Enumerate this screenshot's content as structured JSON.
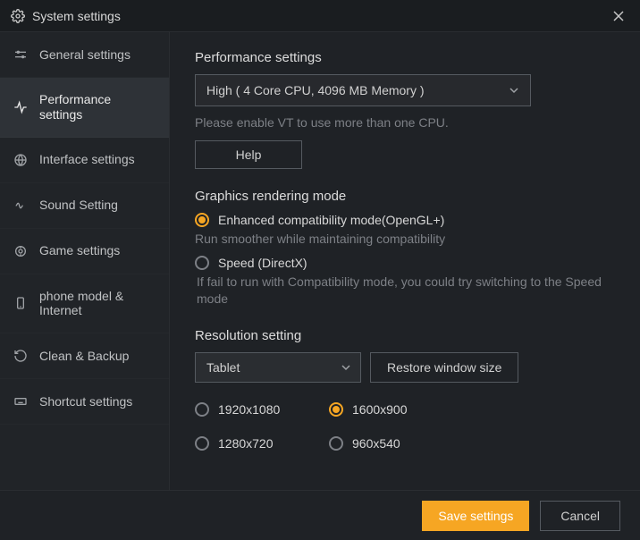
{
  "window": {
    "title": "System settings"
  },
  "sidebar": {
    "items": [
      {
        "label": "General settings"
      },
      {
        "label": "Performance settings"
      },
      {
        "label": "Interface settings"
      },
      {
        "label": "Sound Setting"
      },
      {
        "label": "Game settings"
      },
      {
        "label": "phone model & Internet"
      },
      {
        "label": "Clean & Backup"
      },
      {
        "label": "Shortcut settings"
      }
    ]
  },
  "performance": {
    "title": "Performance settings",
    "selected": "High ( 4 Core CPU, 4096 MB Memory )",
    "vt_hint": "Please enable VT to use more than one CPU.",
    "help_label": "Help"
  },
  "graphics": {
    "title": "Graphics rendering mode",
    "opt1_label": "Enhanced compatibility mode(OpenGL+)",
    "opt1_hint": "Run smoother while maintaining compatibility",
    "opt2_label": "Speed (DirectX)",
    "opt2_hint": " If fail to run with Compatibility mode, you could try switching to the Speed mode"
  },
  "resolution": {
    "title": "Resolution setting",
    "mode_selected": "Tablet",
    "restore_label": "Restore window size",
    "options": [
      {
        "label": "1920x1080"
      },
      {
        "label": "1600x900"
      },
      {
        "label": "1280x720"
      },
      {
        "label": "960x540"
      }
    ]
  },
  "footer": {
    "save_label": "Save settings",
    "cancel_label": "Cancel"
  }
}
